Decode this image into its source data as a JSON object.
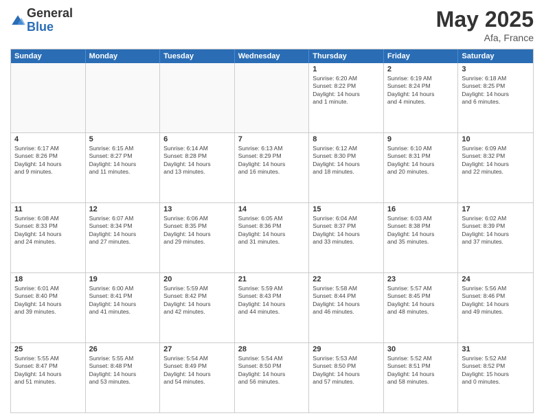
{
  "logo": {
    "general": "General",
    "blue": "Blue"
  },
  "title": {
    "month": "May 2025",
    "location": "Afa, France"
  },
  "days_header": [
    "Sunday",
    "Monday",
    "Tuesday",
    "Wednesday",
    "Thursday",
    "Friday",
    "Saturday"
  ],
  "weeks": [
    [
      {
        "day": "",
        "info": ""
      },
      {
        "day": "",
        "info": ""
      },
      {
        "day": "",
        "info": ""
      },
      {
        "day": "",
        "info": ""
      },
      {
        "day": "1",
        "info": "Sunrise: 6:20 AM\nSunset: 8:22 PM\nDaylight: 14 hours\nand 1 minute."
      },
      {
        "day": "2",
        "info": "Sunrise: 6:19 AM\nSunset: 8:24 PM\nDaylight: 14 hours\nand 4 minutes."
      },
      {
        "day": "3",
        "info": "Sunrise: 6:18 AM\nSunset: 8:25 PM\nDaylight: 14 hours\nand 6 minutes."
      }
    ],
    [
      {
        "day": "4",
        "info": "Sunrise: 6:17 AM\nSunset: 8:26 PM\nDaylight: 14 hours\nand 9 minutes."
      },
      {
        "day": "5",
        "info": "Sunrise: 6:15 AM\nSunset: 8:27 PM\nDaylight: 14 hours\nand 11 minutes."
      },
      {
        "day": "6",
        "info": "Sunrise: 6:14 AM\nSunset: 8:28 PM\nDaylight: 14 hours\nand 13 minutes."
      },
      {
        "day": "7",
        "info": "Sunrise: 6:13 AM\nSunset: 8:29 PM\nDaylight: 14 hours\nand 16 minutes."
      },
      {
        "day": "8",
        "info": "Sunrise: 6:12 AM\nSunset: 8:30 PM\nDaylight: 14 hours\nand 18 minutes."
      },
      {
        "day": "9",
        "info": "Sunrise: 6:10 AM\nSunset: 8:31 PM\nDaylight: 14 hours\nand 20 minutes."
      },
      {
        "day": "10",
        "info": "Sunrise: 6:09 AM\nSunset: 8:32 PM\nDaylight: 14 hours\nand 22 minutes."
      }
    ],
    [
      {
        "day": "11",
        "info": "Sunrise: 6:08 AM\nSunset: 8:33 PM\nDaylight: 14 hours\nand 24 minutes."
      },
      {
        "day": "12",
        "info": "Sunrise: 6:07 AM\nSunset: 8:34 PM\nDaylight: 14 hours\nand 27 minutes."
      },
      {
        "day": "13",
        "info": "Sunrise: 6:06 AM\nSunset: 8:35 PM\nDaylight: 14 hours\nand 29 minutes."
      },
      {
        "day": "14",
        "info": "Sunrise: 6:05 AM\nSunset: 8:36 PM\nDaylight: 14 hours\nand 31 minutes."
      },
      {
        "day": "15",
        "info": "Sunrise: 6:04 AM\nSunset: 8:37 PM\nDaylight: 14 hours\nand 33 minutes."
      },
      {
        "day": "16",
        "info": "Sunrise: 6:03 AM\nSunset: 8:38 PM\nDaylight: 14 hours\nand 35 minutes."
      },
      {
        "day": "17",
        "info": "Sunrise: 6:02 AM\nSunset: 8:39 PM\nDaylight: 14 hours\nand 37 minutes."
      }
    ],
    [
      {
        "day": "18",
        "info": "Sunrise: 6:01 AM\nSunset: 8:40 PM\nDaylight: 14 hours\nand 39 minutes."
      },
      {
        "day": "19",
        "info": "Sunrise: 6:00 AM\nSunset: 8:41 PM\nDaylight: 14 hours\nand 41 minutes."
      },
      {
        "day": "20",
        "info": "Sunrise: 5:59 AM\nSunset: 8:42 PM\nDaylight: 14 hours\nand 42 minutes."
      },
      {
        "day": "21",
        "info": "Sunrise: 5:59 AM\nSunset: 8:43 PM\nDaylight: 14 hours\nand 44 minutes."
      },
      {
        "day": "22",
        "info": "Sunrise: 5:58 AM\nSunset: 8:44 PM\nDaylight: 14 hours\nand 46 minutes."
      },
      {
        "day": "23",
        "info": "Sunrise: 5:57 AM\nSunset: 8:45 PM\nDaylight: 14 hours\nand 48 minutes."
      },
      {
        "day": "24",
        "info": "Sunrise: 5:56 AM\nSunset: 8:46 PM\nDaylight: 14 hours\nand 49 minutes."
      }
    ],
    [
      {
        "day": "25",
        "info": "Sunrise: 5:55 AM\nSunset: 8:47 PM\nDaylight: 14 hours\nand 51 minutes."
      },
      {
        "day": "26",
        "info": "Sunrise: 5:55 AM\nSunset: 8:48 PM\nDaylight: 14 hours\nand 53 minutes."
      },
      {
        "day": "27",
        "info": "Sunrise: 5:54 AM\nSunset: 8:49 PM\nDaylight: 14 hours\nand 54 minutes."
      },
      {
        "day": "28",
        "info": "Sunrise: 5:54 AM\nSunset: 8:50 PM\nDaylight: 14 hours\nand 56 minutes."
      },
      {
        "day": "29",
        "info": "Sunrise: 5:53 AM\nSunset: 8:50 PM\nDaylight: 14 hours\nand 57 minutes."
      },
      {
        "day": "30",
        "info": "Sunrise: 5:52 AM\nSunset: 8:51 PM\nDaylight: 14 hours\nand 58 minutes."
      },
      {
        "day": "31",
        "info": "Sunrise: 5:52 AM\nSunset: 8:52 PM\nDaylight: 15 hours\nand 0 minutes."
      }
    ]
  ]
}
